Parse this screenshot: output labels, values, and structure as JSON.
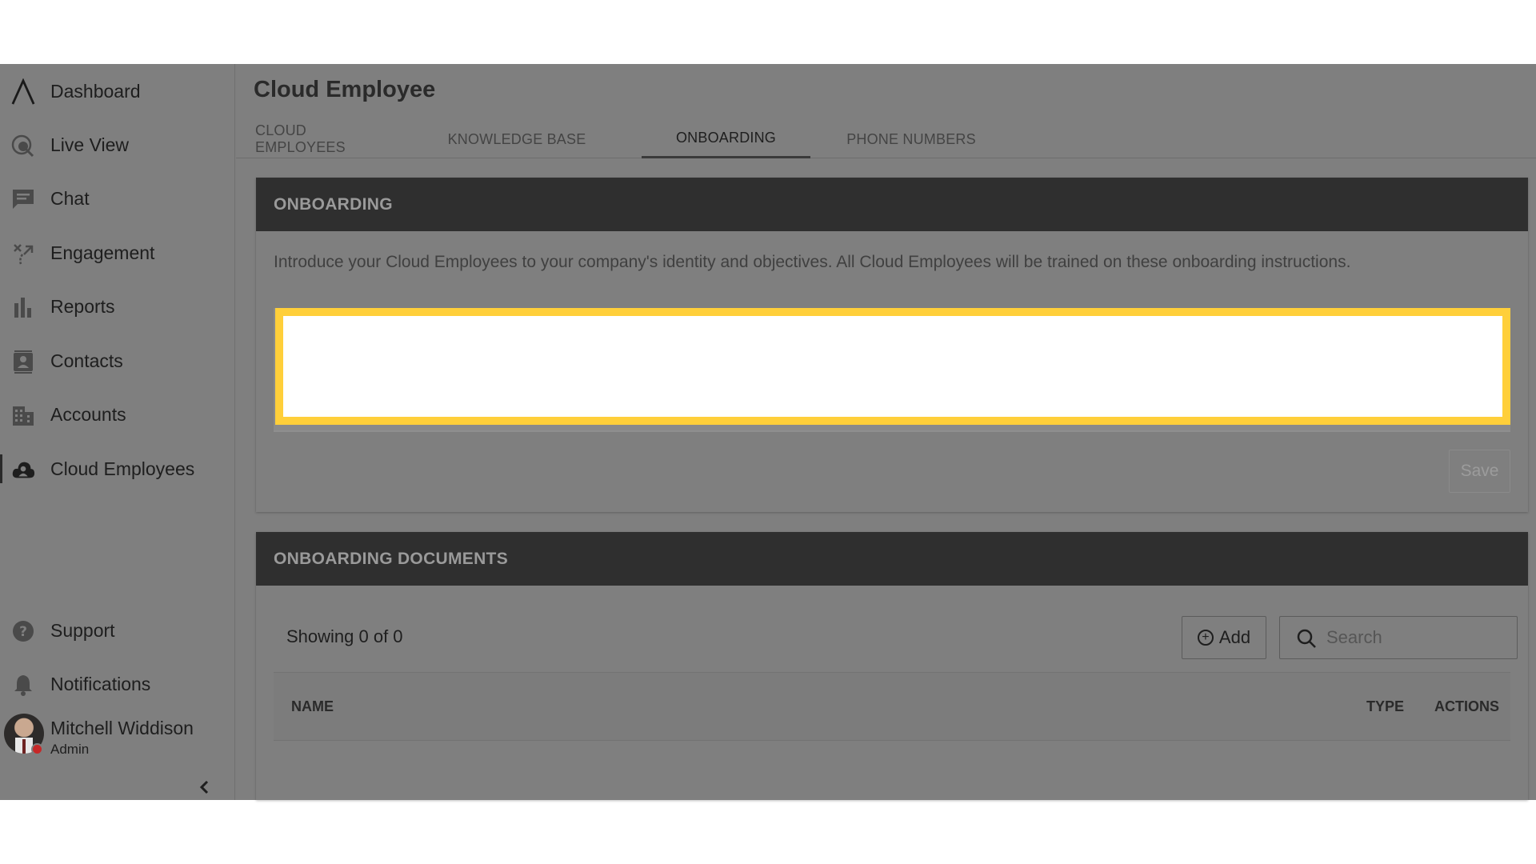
{
  "sidebar": {
    "items": [
      {
        "label": "Dashboard",
        "icon": "logo-icon"
      },
      {
        "label": "Live View",
        "icon": "live-view-icon"
      },
      {
        "label": "Chat",
        "icon": "chat-icon"
      },
      {
        "label": "Engagement",
        "icon": "engagement-icon"
      },
      {
        "label": "Reports",
        "icon": "bar-chart-icon"
      },
      {
        "label": "Contacts",
        "icon": "contacts-icon"
      },
      {
        "label": "Accounts",
        "icon": "building-icon"
      },
      {
        "label": "Cloud Employees",
        "icon": "cloud-person-icon",
        "active": true
      }
    ],
    "bottom_items": [
      {
        "label": "Support",
        "icon": "help-icon"
      },
      {
        "label": "Notifications",
        "icon": "bell-icon"
      }
    ],
    "profile": {
      "name": "Mitchell Widdison",
      "role": "Admin",
      "status_color": "#c62828"
    }
  },
  "page": {
    "title": "Cloud Employee",
    "tabs": [
      {
        "label": "CLOUD EMPLOYEES"
      },
      {
        "label": "KNOWLEDGE BASE"
      },
      {
        "label": "ONBOARDING",
        "active": true
      },
      {
        "label": "PHONE NUMBERS"
      }
    ]
  },
  "onboarding": {
    "header": "ONBOARDING",
    "description": "Introduce your Cloud Employees to your company's identity and objectives. All Cloud Employees will be trained on these onboarding instructions.",
    "editor_value": "",
    "highlight_color": "#ffcf3a",
    "save_label": "Save"
  },
  "documents": {
    "header": "ONBOARDING DOCUMENTS",
    "showing": "Showing 0 of  0",
    "add_label": "Add",
    "search_placeholder": "Search",
    "columns": {
      "name": "NAME",
      "type": "TYPE",
      "actions": "ACTIONS"
    }
  }
}
